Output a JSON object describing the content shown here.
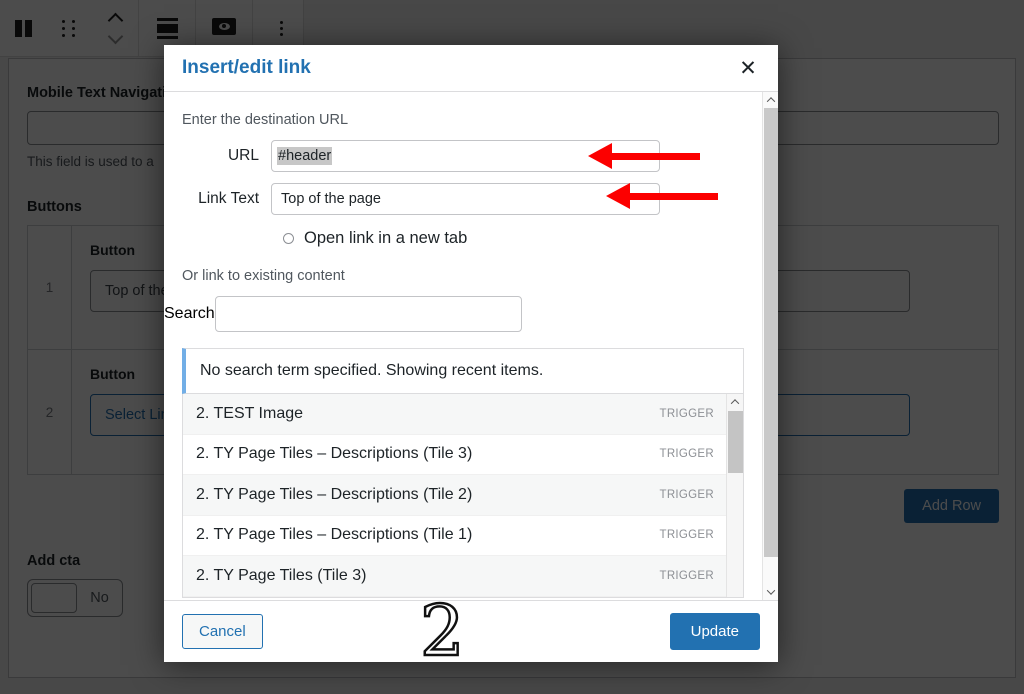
{
  "editor_toolbar": {
    "buttons": [
      {
        "name": "columns-icon",
        "label": "Columns block"
      },
      {
        "name": "drag-handle-icon",
        "label": "Drag"
      },
      {
        "name": "move-up-down-icon",
        "label": "Move up or down"
      },
      {
        "name": "align-icon",
        "label": "Change alignment"
      },
      {
        "name": "preview-icon",
        "label": "Preview"
      },
      {
        "name": "more-options-icon",
        "label": "Options"
      }
    ]
  },
  "background": {
    "mobile_nav": {
      "label": "Mobile Text Navigation",
      "input_value": "",
      "help_text": "This field is used to a"
    },
    "buttons_section": {
      "title": "Buttons",
      "rows": [
        {
          "index": "1",
          "cell_label": "Button",
          "link_value": "Top of the page",
          "state": "filled"
        },
        {
          "index": "2",
          "cell_label": "Button",
          "link_value": "Select Link",
          "state": "empty"
        }
      ],
      "add_row_label": "Add Row"
    },
    "add_cta": {
      "label": "Add cta",
      "toggle_value": "No"
    }
  },
  "modal": {
    "title": "Insert/edit link",
    "close_label": "✕",
    "destination_hint": "Enter the destination URL",
    "fields": [
      {
        "label": "URL",
        "value": "#header",
        "selected": true
      },
      {
        "label": "Link Text",
        "value": "Top of the page",
        "selected": false
      }
    ],
    "new_tab_label": "Open link in a new tab",
    "new_tab_checked": false,
    "existing_content_hint": "Or link to existing content",
    "search": {
      "label": "Search",
      "value": "",
      "placeholder": ""
    },
    "notice": "No search term specified. Showing recent items.",
    "results": [
      {
        "title": "2. TEST Image",
        "type": "TRIGGER"
      },
      {
        "title": "2. TY Page Tiles – Descriptions (Tile 3)",
        "type": "TRIGGER"
      },
      {
        "title": "2. TY Page Tiles – Descriptions (Tile 2)",
        "type": "TRIGGER"
      },
      {
        "title": "2. TY Page Tiles – Descriptions (Tile 1)",
        "type": "TRIGGER"
      },
      {
        "title": "2. TY Page Tiles (Tile 3)",
        "type": "TRIGGER"
      }
    ],
    "cancel_label": "Cancel",
    "update_label": "Update"
  },
  "annotations": {
    "step_number": "2",
    "arrow_color": "#fc0000",
    "arrows": [
      {
        "target": "url-field"
      },
      {
        "target": "link-text-field"
      }
    ]
  },
  "colors": {
    "accent": "#2271b1",
    "annotation_red": "#fc0000",
    "notice_bar": "#72aee6"
  }
}
